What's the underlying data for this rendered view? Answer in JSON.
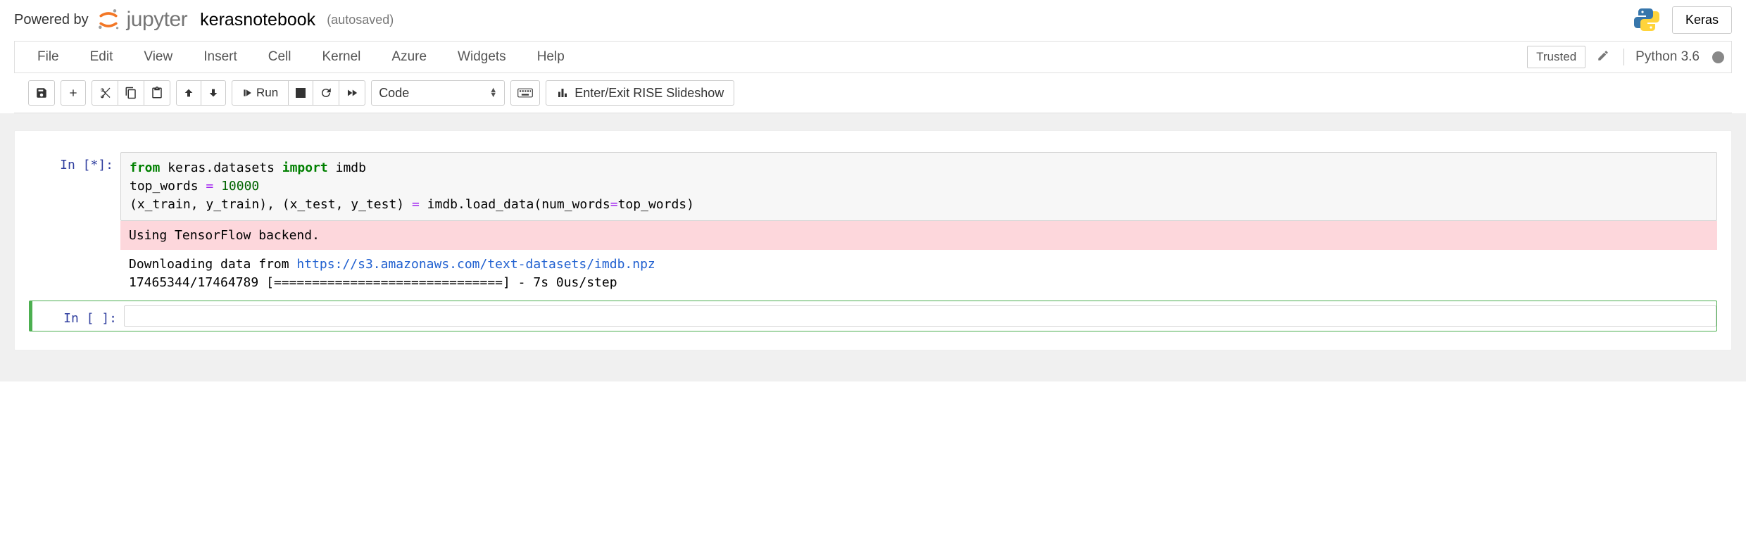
{
  "header": {
    "powered_by": "Powered by",
    "jupyter_word": "jupyter",
    "notebook_name": "kerasnotebook",
    "autosave": "(autosaved)",
    "keras_label": "Keras"
  },
  "menubar": {
    "items": [
      "File",
      "Edit",
      "View",
      "Insert",
      "Cell",
      "Kernel",
      "Azure",
      "Widgets",
      "Help"
    ],
    "trusted": "Trusted",
    "kernel": "Python 3.6"
  },
  "toolbar": {
    "run_label": "Run",
    "celltype": "Code",
    "rise_label": "Enter/Exit RISE Slideshow"
  },
  "cells": {
    "c1_prompt": "In [*]:",
    "c1_code": {
      "l1_from": "from",
      "l1_mod": " keras.datasets ",
      "l1_import": "import",
      "l1_name": " imdb",
      "l2_a": "top_words ",
      "l2_eq": "=",
      "l2_sp": " ",
      "l2_num": "10000",
      "l3_a": "(x_train, y_train), (x_test, y_test) ",
      "l3_eq": "=",
      "l3_b": " imdb.load_data(num_words",
      "l3_eq2": "=",
      "l3_c": "top_words)"
    },
    "stderr": "Using TensorFlow backend.",
    "stdout_a": "Downloading data from ",
    "stdout_link": "https://s3.amazonaws.com/text-datasets/imdb.npz",
    "stdout_b": "17465344/17464789 [==============================] - 7s 0us/step",
    "c2_prompt": "In [ ]:",
    "c2_code": ""
  }
}
